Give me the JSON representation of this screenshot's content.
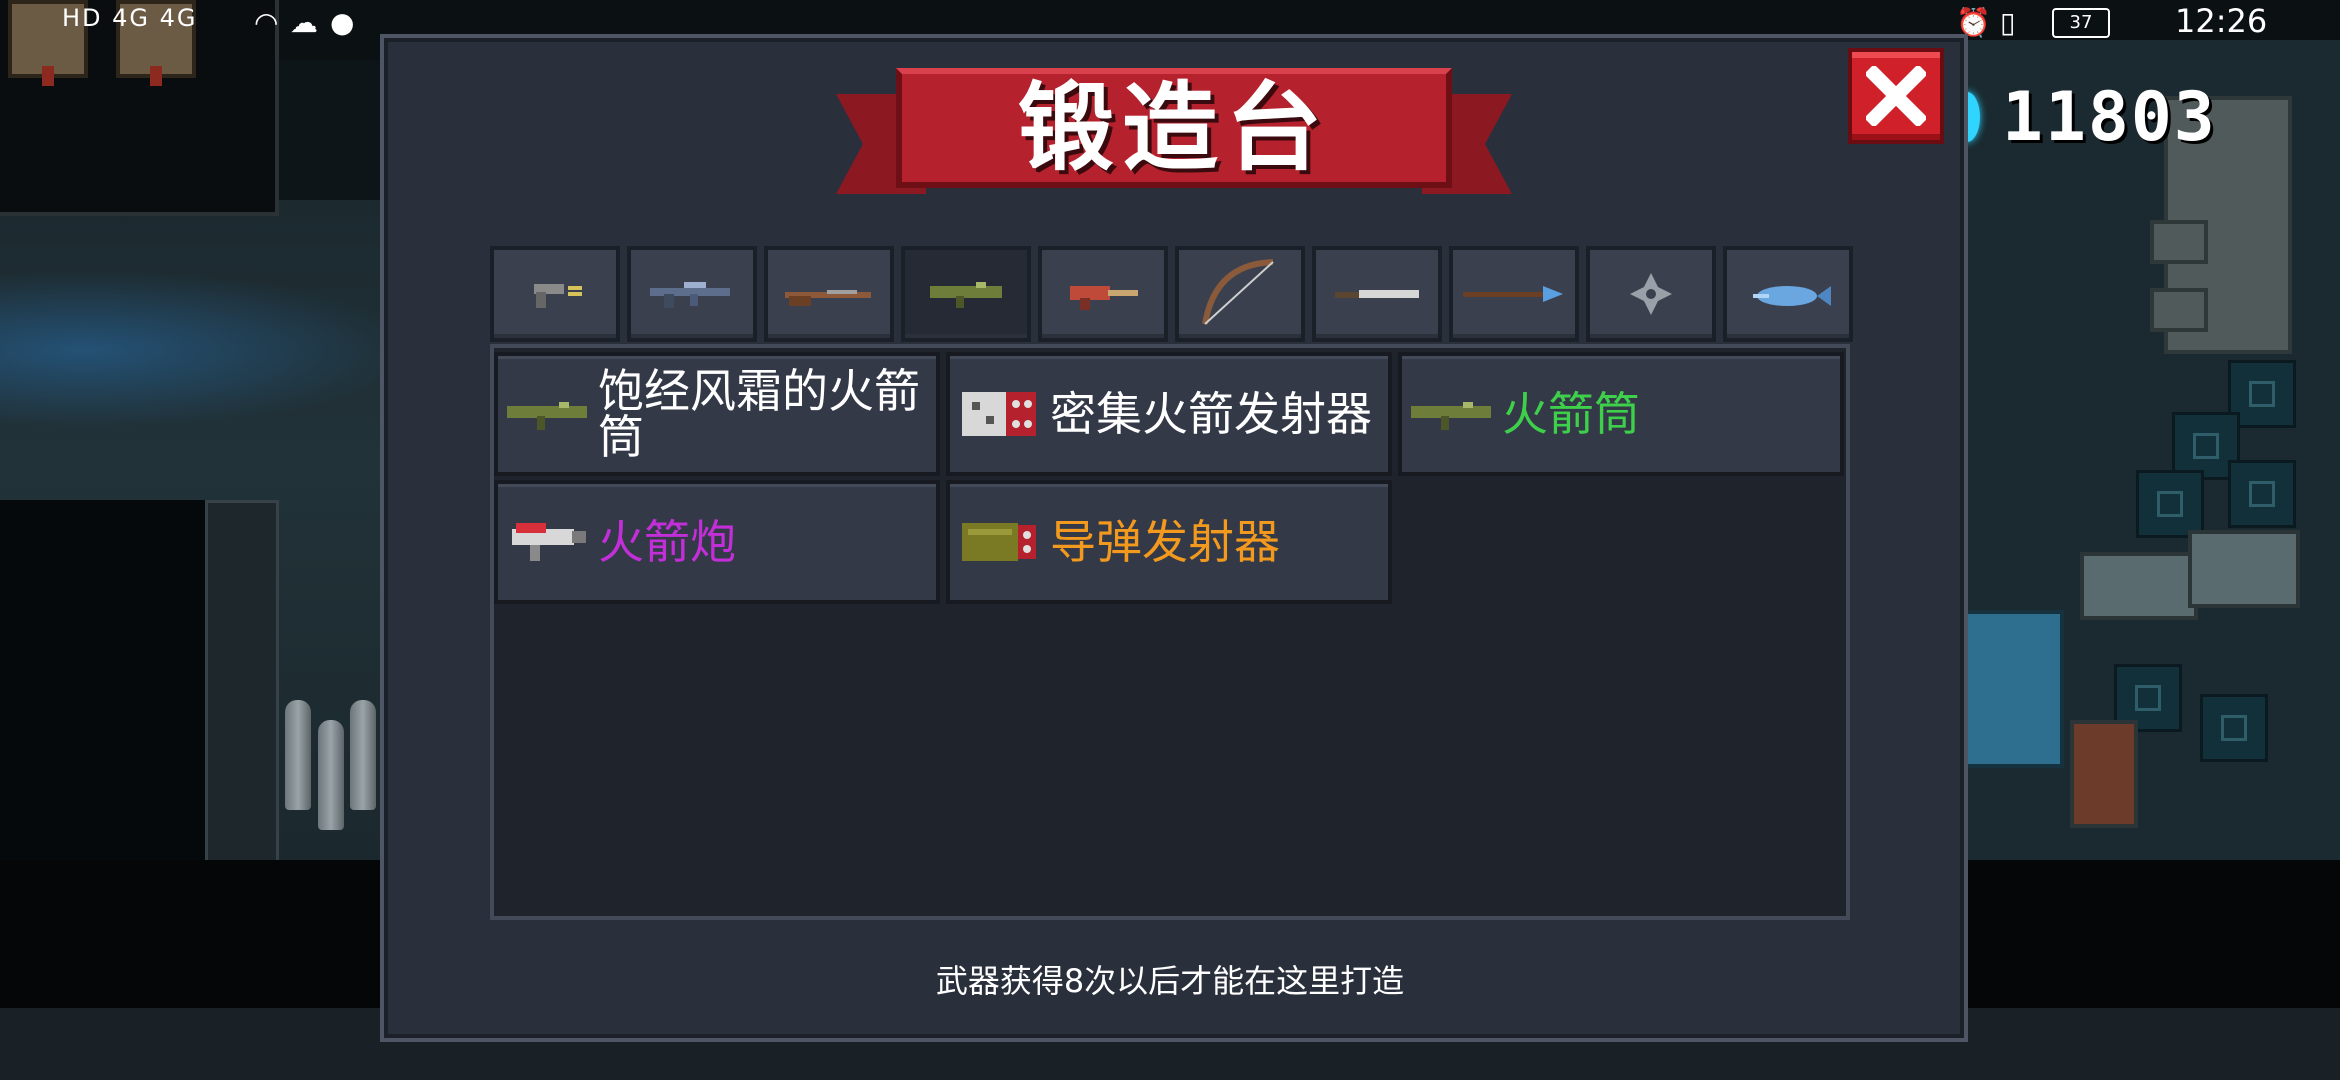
{
  "status_bar": {
    "network_left": "HD 4G 4G",
    "battery": "37",
    "time": "12:26"
  },
  "currency": {
    "icon": "gem-icon",
    "count": "11803"
  },
  "dialog": {
    "title": "锻造台",
    "close_icon": "close-x-icon",
    "tabs": [
      {
        "icon": "pistol-icon",
        "active": false
      },
      {
        "icon": "rifle-icon",
        "active": false
      },
      {
        "icon": "shotgun-icon",
        "active": false
      },
      {
        "icon": "rocket-launcher-icon",
        "active": true
      },
      {
        "icon": "flamethrower-icon",
        "active": false
      },
      {
        "icon": "bow-icon",
        "active": false
      },
      {
        "icon": "sword-icon",
        "active": false
      },
      {
        "icon": "spear-icon",
        "active": false
      },
      {
        "icon": "shuriken-icon",
        "active": false
      },
      {
        "icon": "fish-weapon-icon",
        "active": false
      }
    ],
    "items": [
      {
        "label": "饱经风霜的火箭筒",
        "color": "#ffffff",
        "icon": "bazooka-icon"
      },
      {
        "label": "密集火箭发射器",
        "color": "#ffffff",
        "icon": "rocket-pod-icon"
      },
      {
        "label": "火箭筒",
        "color": "#3ed04a",
        "icon": "bazooka-icon"
      },
      {
        "label": "火箭炮",
        "color": "#c22fd8",
        "icon": "rocket-cannon-icon"
      },
      {
        "label": "导弹发射器",
        "color": "#f39a1e",
        "icon": "missile-launcher-icon"
      }
    ],
    "footer_note": "武器获得8次以后才能在这里打造"
  }
}
